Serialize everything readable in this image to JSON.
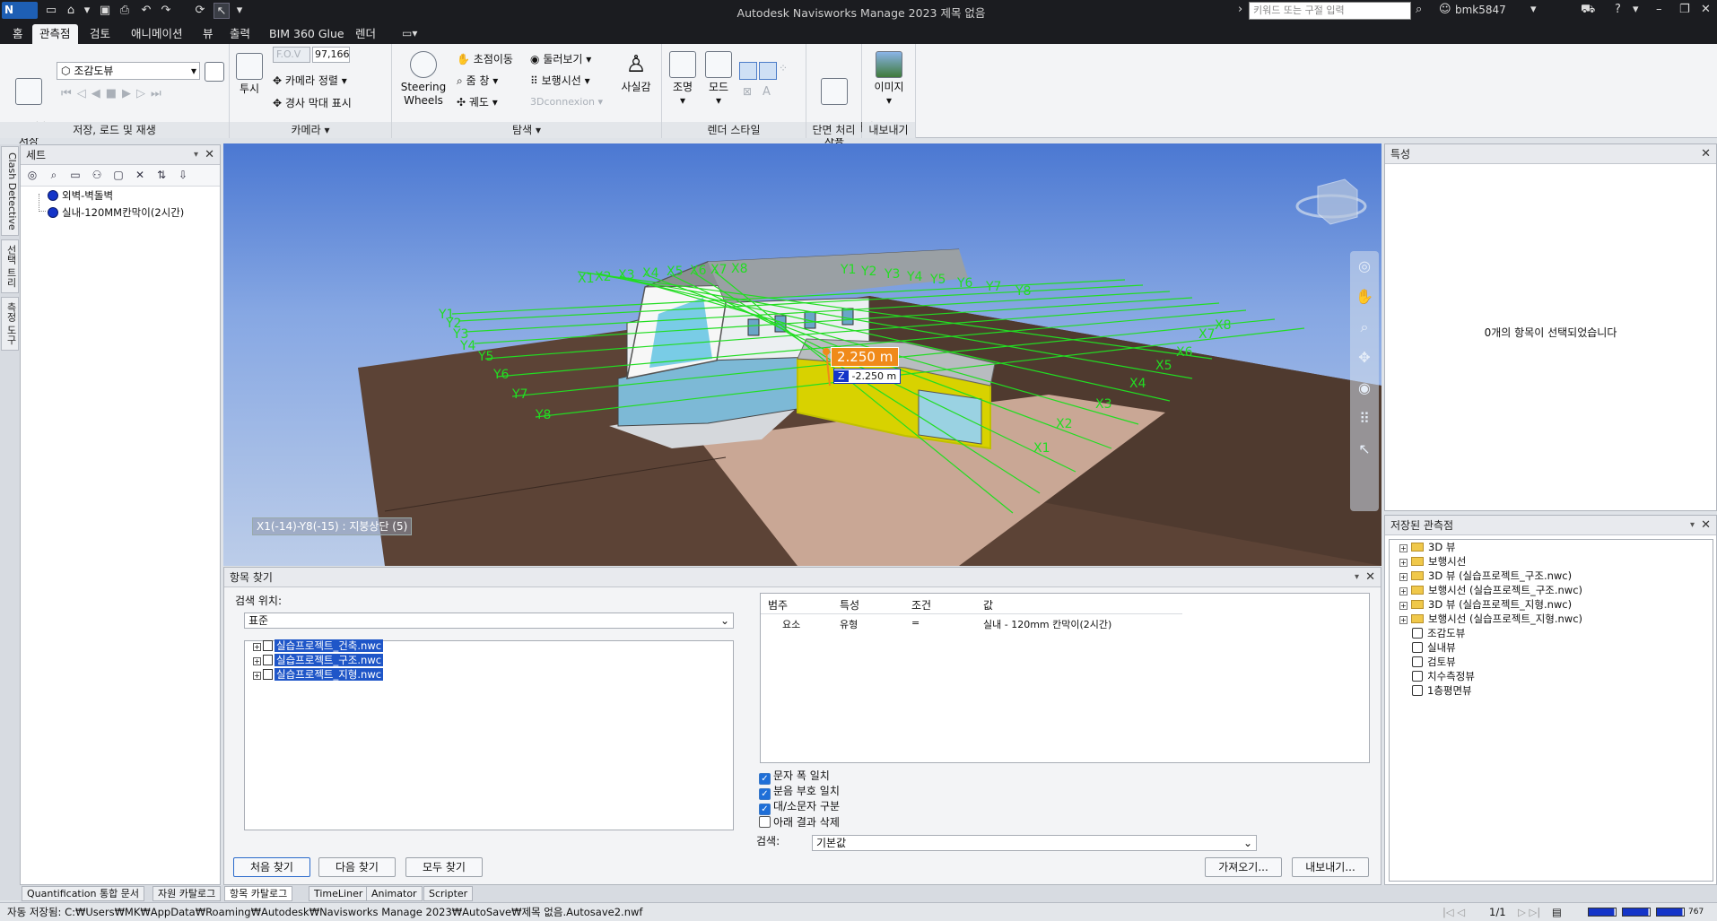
{
  "app": {
    "title": "Autodesk Navisworks Manage 2023    제목 없음",
    "logo": "N MAN",
    "search_placeholder": "키워드 또는 구절 입력",
    "user": "bmk5847"
  },
  "tabs": [
    "홈",
    "관측점",
    "검토",
    "애니메이션",
    "뷰",
    "출력",
    "BIM 360 Glue",
    "렌더"
  ],
  "active_tab": "관측점",
  "ribbon": {
    "save_load": {
      "title": "저장, 로드 및 재생",
      "save_viewpoint": "관측점\n저장",
      "viewpoint_select": "조감도뷰"
    },
    "camera": {
      "title": "카메라",
      "perspective": "투시",
      "fov_label": "F.O.V",
      "fov_value": "97,166",
      "align_camera": "카메라 정렬",
      "show_tilt": "경사 막대 표시"
    },
    "navigate": {
      "title": "탐색",
      "steering_wheels": "Steering Wheels",
      "pan": "초점이동",
      "orbit": "둘러보기",
      "zoom": "줌 창",
      "walk": "보행시선",
      "orbit2": "궤도",
      "connexion": "3Dconnexion",
      "realism": "사실감"
    },
    "render_style": {
      "title": "렌더 스타일",
      "lighting": "조명",
      "mode": "모드"
    },
    "sectioning": {
      "title": "단면 처리",
      "enable": "단면 처리\n사용"
    },
    "export": {
      "title": "내보내기",
      "image": "이미지"
    }
  },
  "left_vertical_tabs": [
    "Clash Detective",
    "선택 트리",
    "측정 도구"
  ],
  "sets_panel": {
    "title": "세트",
    "items": [
      "외벽-벽돌벽",
      "실내-120MM칸막이(2시간)"
    ]
  },
  "viewport": {
    "grid_x": [
      "X1",
      "X2",
      "X3",
      "X4",
      "X5",
      "X6",
      "X7",
      "X8"
    ],
    "grid_y": [
      "Y1",
      "Y2",
      "Y3",
      "Y4",
      "Y5",
      "Y6",
      "Y7",
      "Y8"
    ],
    "measure_value": "2.250 m",
    "z_label": "Z",
    "z_value": "-2.250 m",
    "location_readout": "X1(-14)-Y8(-15) : 지붕상단 (5)"
  },
  "find_items": {
    "title": "항목 찾기",
    "search_in_label": "검색 위치:",
    "search_in_value": "표준",
    "files": [
      "실습프로젝트_건축.nwc",
      "실습프로젝트_구조.nwc",
      "실습프로젝트_지형.nwc"
    ],
    "columns": [
      "범주",
      "특성",
      "조건",
      "값"
    ],
    "row": [
      "요소",
      "유형",
      "=",
      "실내 - 120mm 칸막이(2시간)"
    ],
    "options": [
      {
        "label": "문자 폭 일치",
        "checked": true
      },
      {
        "label": "분음 부호 일치",
        "checked": true
      },
      {
        "label": "대/소문자 구분",
        "checked": true
      },
      {
        "label": "아래 결과 삭제",
        "checked": false
      }
    ],
    "search_label": "검색:",
    "search_value": "기본값",
    "buttons": {
      "find_first": "처음 찾기",
      "find_next": "다음 찾기",
      "find_all": "모두 찾기",
      "import": "가져오기...",
      "export": "내보내기..."
    }
  },
  "properties_panel": {
    "title": "특성",
    "empty_message": "0개의 항목이 선택되었습니다"
  },
  "saved_viewpoints": {
    "title": "저장된 관측점",
    "folders": [
      "3D 뷰",
      "보행시선",
      "3D 뷰 (실습프로젝트_구조.nwc)",
      "보행시선 (실습프로젝트_구조.nwc)",
      "3D 뷰 (실습프로젝트_지형.nwc)",
      "보행시선 (실습프로젝트_지형.nwc)"
    ],
    "views": [
      "조감도뷰",
      "실내뷰",
      "검토뷰",
      "치수측정뷰",
      "1층평면뷰"
    ]
  },
  "bottom_tabs": [
    "Quantification 통합 문서",
    "자원 카탈로그",
    "항목 카탈로그",
    "TimeLiner",
    "Animator",
    "Scripter"
  ],
  "active_bottom_tab": "항목 카탈로그",
  "status": {
    "autosave": "자동 저장됨: C:₩Users₩MK₩AppData₩Roaming₩Autodesk₩Navisworks Manage 2023₩AutoSave₩제목 없음.Autosave2.nwf",
    "page": "1/1",
    "memory": "767 MB"
  },
  "colors": {
    "grid_line": "#22dd22",
    "measure_badge": "#f08a1a",
    "selection_yellow": "#d8d200",
    "accent_blue": "#1f56c8"
  }
}
